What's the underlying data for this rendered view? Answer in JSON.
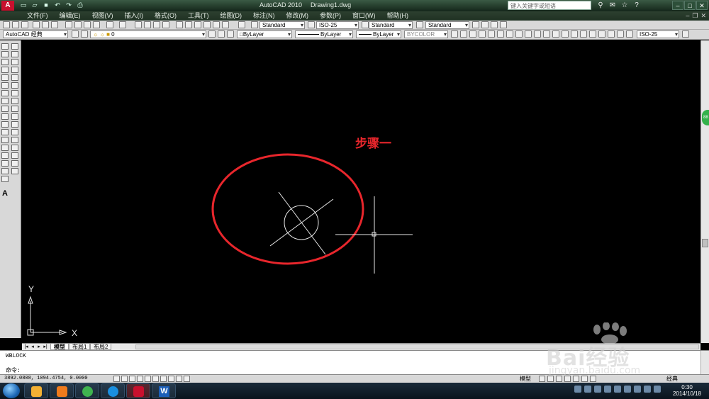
{
  "titlebar": {
    "app_title": "AutoCAD 2010",
    "document": "Drawing1.dwg",
    "search_placeholder": "键入关键字或短语",
    "app_icon": "A"
  },
  "menubar": {
    "items": [
      "文件(F)",
      "编辑(E)",
      "视图(V)",
      "插入(I)",
      "格式(O)",
      "工具(T)",
      "绘图(D)",
      "标注(N)",
      "修改(M)",
      "参数(P)",
      "窗口(W)",
      "帮助(H)"
    ]
  },
  "toolbar1": {
    "text_style": "Standard",
    "dim_style": "ISO-25",
    "table_style": "Standard",
    "mleader_style": "Standard"
  },
  "toolbar2": {
    "workspace": "AutoCAD 经典",
    "layer": "0",
    "color": "ByLayer",
    "linetype": "ByLayer",
    "lineweight": "ByLayer",
    "plot_style": "BYCOLOR",
    "dim_style": "ISO-25"
  },
  "canvas": {
    "annotation": "步骤一",
    "ucs_x_label": "X",
    "ucs_y_label": "Y",
    "annotation_color": "#e8262c"
  },
  "layout_tabs": [
    "模型",
    "布局1",
    "布局2"
  ],
  "command": {
    "history": "WBLOCK",
    "prompt": "命令:"
  },
  "status": {
    "coordinates": "3892.0808, 1094.4754, 0.0000",
    "space": "模型",
    "workspace_short": "经典"
  },
  "taskbar": {
    "word_glyph": "W",
    "time": "0:30",
    "date": "2014/10/18"
  },
  "watermark": {
    "brand": "Bai",
    "brand2": "经验",
    "site": "jingyan.baidu.com"
  }
}
